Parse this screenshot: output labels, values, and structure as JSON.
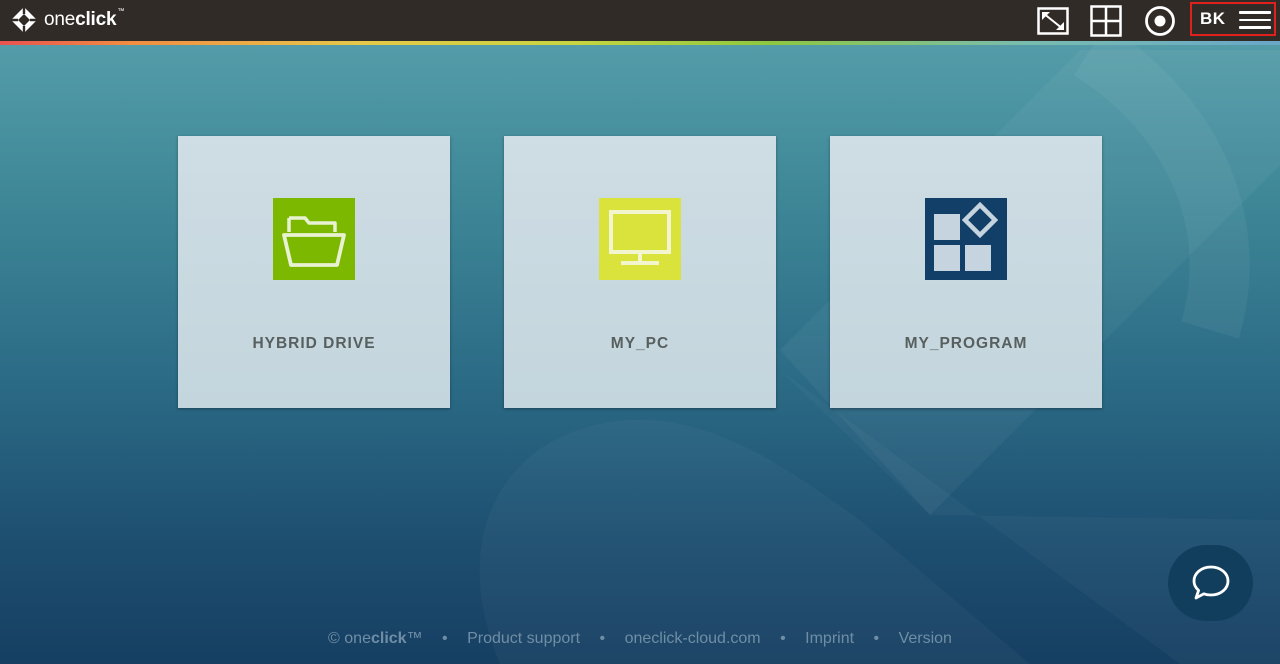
{
  "header": {
    "logo_text_regular": "one",
    "logo_text_bold": "click",
    "logo_tm": "™",
    "user_initials": "BK",
    "icons": {
      "fullscreen": "fullscreen-icon",
      "grid": "grid-view-icon",
      "record": "record-icon",
      "menu": "hamburger-menu-icon"
    }
  },
  "tiles": [
    {
      "label": "HYBRID DRIVE",
      "icon": "folder-icon",
      "color": "#7cb800"
    },
    {
      "label": "MY_PC",
      "icon": "monitor-icon",
      "color": "#d9e33b"
    },
    {
      "label": "MY_PROGRAM",
      "icon": "apps-grid-icon",
      "color": "#123f68"
    }
  ],
  "footer": {
    "copyright_prefix": "© one",
    "copyright_bold": "click",
    "copyright_suffix": "™",
    "links": [
      "Product support",
      "oneclick-cloud.com",
      "Imprint",
      "Version"
    ]
  },
  "chat": {
    "icon": "chat-bubble-icon"
  },
  "colors": {
    "topbar": "#312b28",
    "accent_red": "#e0201c",
    "tile_bg": "#cfdde4",
    "tile_label": "#58605f",
    "chat_bg": "#123e5e"
  }
}
